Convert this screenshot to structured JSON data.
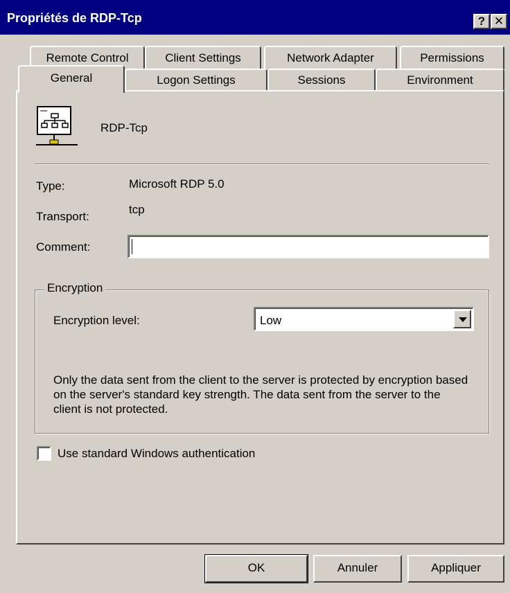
{
  "window": {
    "title": "Propriétés de RDP-Tcp",
    "help_button": "?",
    "close_button": "✕"
  },
  "tabs": {
    "back_row": [
      "Remote Control",
      "Client Settings",
      "Network Adapter",
      "Permissions"
    ],
    "front_row": [
      "General",
      "Logon Settings",
      "Sessions",
      "Environment"
    ],
    "active": "General"
  },
  "general": {
    "connection_name": "RDP-Tcp",
    "type_label": "Type:",
    "type_value": "Microsoft RDP 5.0",
    "transport_label": "Transport:",
    "transport_value": "tcp",
    "comment_label": "Comment:",
    "comment_value": "",
    "encryption": {
      "group_title": "Encryption",
      "level_label": "Encryption level:",
      "level_value": "Low",
      "description": "Only the data sent from the client to the server is protected by encryption based on the server's standard key strength.  The data sent from the server to the client is not protected."
    },
    "windows_auth_label": "Use standard Windows authentication",
    "windows_auth_checked": false
  },
  "buttons": {
    "ok": "OK",
    "cancel": "Annuler",
    "apply": "Appliquer"
  },
  "colors": {
    "titlebar": "#000080",
    "face": "#d4d0c8"
  },
  "icons": [
    "network-connection-icon",
    "help-icon",
    "close-icon",
    "dropdown-arrow-icon"
  ]
}
